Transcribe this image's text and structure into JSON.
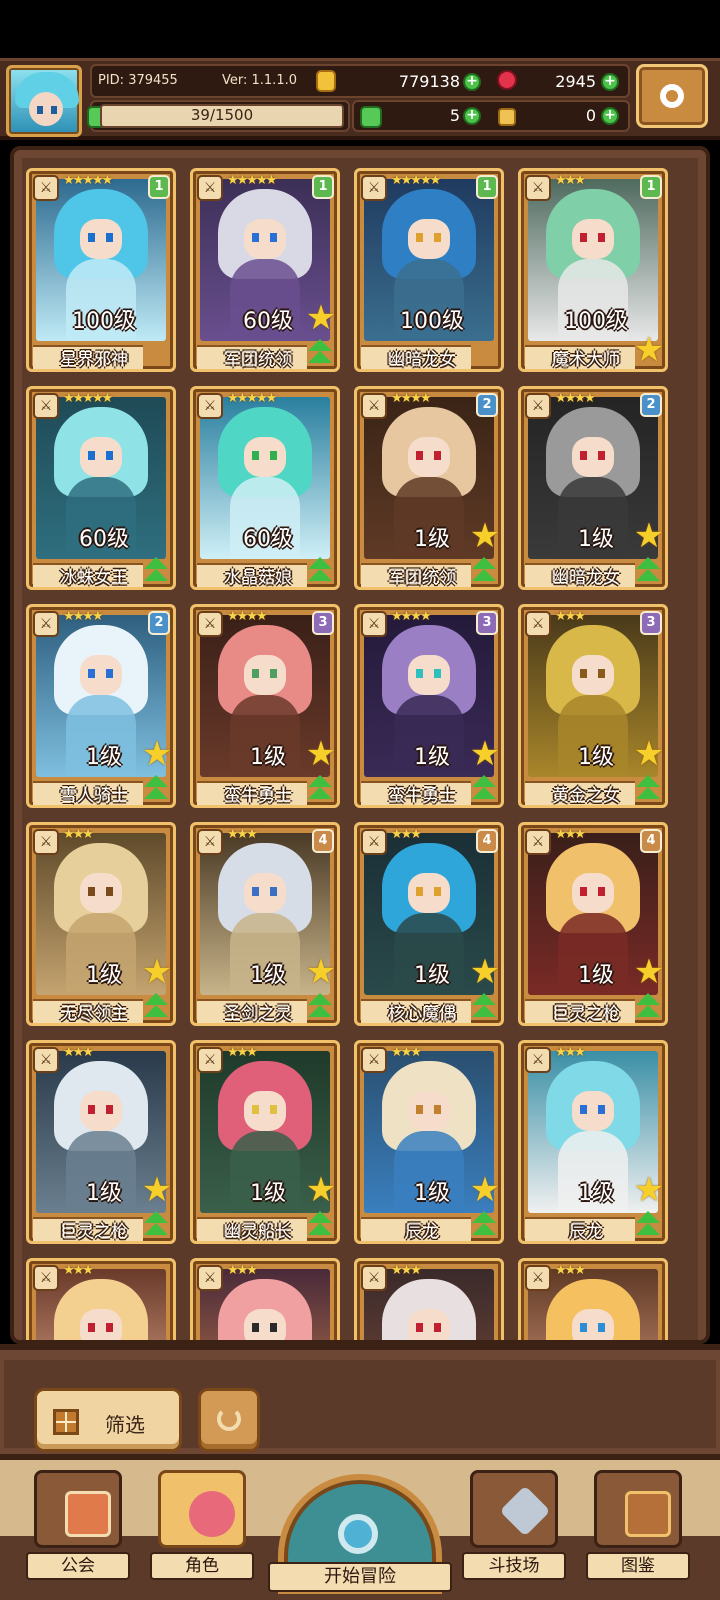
{
  "header": {
    "pid": "PID: 379455",
    "version": "Ver: 1.1.1.0",
    "gold": "779138",
    "gems": "2945",
    "exp": "39/1500",
    "clover_count": "5",
    "bone_count": "0"
  },
  "characters": [
    {
      "level": "100级",
      "name": "星界邪神",
      "stars": "★★★★★",
      "rank": "1",
      "star_badge": false,
      "up": false,
      "hair": "#4fc6e8",
      "body": "#bfeaf6",
      "bg": "#2d6a8f",
      "eye": "#1a6fd0"
    },
    {
      "level": "60级",
      "name": "军团统领",
      "stars": "★★★★★",
      "rank": "1",
      "star_badge": true,
      "up": true,
      "hair": "#d9d9e6",
      "body": "#6a4f8f",
      "bg": "#3b2f56",
      "eye": "#2a6fd6"
    },
    {
      "level": "100级",
      "name": "幽暗龙女",
      "stars": "★★★★★",
      "rank": "1",
      "star_badge": false,
      "up": false,
      "hair": "#2f7fc4",
      "body": "#3b6f8f",
      "bg": "#1f3a5f",
      "eye": "#e0a030"
    },
    {
      "level": "100级",
      "name": "魔术大师",
      "stars": "★★★",
      "rank": "1",
      "star_badge": true,
      "up": false,
      "hair": "#7fcfa8",
      "body": "#e8e8e8",
      "bg": "#4f6a5f",
      "eye": "#c02030"
    },
    {
      "level": "60级",
      "name": "冰蛛女王",
      "stars": "★★★★★",
      "rank": "",
      "star_badge": false,
      "up": true,
      "hair": "#8fe3e6",
      "body": "#2f6f7f",
      "bg": "#1f4a56",
      "eye": "#1a6fd0"
    },
    {
      "level": "60级",
      "name": "水晶菇娘",
      "stars": "★★★★★",
      "rank": "",
      "star_badge": false,
      "up": true,
      "hair": "#4fd6c4",
      "body": "#cfeff6",
      "bg": "#2a7f9f",
      "eye": "#2faf4f"
    },
    {
      "level": "1级",
      "name": "军团统领",
      "stars": "★★★★",
      "rank": "2",
      "star_badge": true,
      "up": true,
      "hair": "#e6c79f",
      "body": "#5f3a26",
      "bg": "#3a2416",
      "eye": "#c02030"
    },
    {
      "level": "1级",
      "name": "幽暗龙女",
      "stars": "★★★★",
      "rank": "2",
      "star_badge": true,
      "up": true,
      "hair": "#9a9a9a",
      "body": "#3a3a3a",
      "bg": "#242424",
      "eye": "#c02030"
    },
    {
      "level": "1级",
      "name": "雪人骑士",
      "stars": "★★★★",
      "rank": "2",
      "star_badge": true,
      "up": true,
      "hair": "#e8f4fa",
      "body": "#7fbfdf",
      "bg": "#2f5f7f",
      "eye": "#2a6fd6"
    },
    {
      "level": "1级",
      "name": "蛮牛勇士",
      "stars": "★★★★",
      "rank": "3",
      "star_badge": true,
      "up": true,
      "hair": "#e88a86",
      "body": "#6a3a2a",
      "bg": "#3a2018",
      "eye": "#4fa060"
    },
    {
      "level": "1级",
      "name": "蛮牛勇士",
      "stars": "★★★★",
      "rank": "3",
      "star_badge": true,
      "up": true,
      "hair": "#9a7fc4",
      "body": "#3a2a56",
      "bg": "#241a3a",
      "eye": "#2fbfbf"
    },
    {
      "level": "1级",
      "name": "黄金之女",
      "stars": "★★★",
      "rank": "3",
      "star_badge": true,
      "up": true,
      "hair": "#d9b84a",
      "body": "#a8862a",
      "bg": "#4a3a1a",
      "eye": "#8a5a1a"
    },
    {
      "level": "1级",
      "name": "无尽领主",
      "stars": "★★★",
      "rank": "",
      "star_badge": true,
      "up": true,
      "hair": "#e6cf9a",
      "body": "#c4a470",
      "bg": "#5f4a2a",
      "eye": "#7a4a1a"
    },
    {
      "level": "1级",
      "name": "圣剑之灵",
      "stars": "★★★",
      "rank": "4",
      "star_badge": true,
      "up": true,
      "hair": "#d6dde6",
      "body": "#c8b48a",
      "bg": "#4a3a26",
      "eye": "#3a6fc4"
    },
    {
      "level": "1级",
      "name": "核心魔偶",
      "stars": "★★★",
      "rank": "4",
      "star_badge": true,
      "up": true,
      "hair": "#2fa6d9",
      "body": "#2a4a4a",
      "bg": "#1a2f36",
      "eye": "#e0a030"
    },
    {
      "level": "1级",
      "name": "巨灵之枪",
      "stars": "★★★",
      "rank": "4",
      "star_badge": true,
      "up": true,
      "hair": "#f0c06a",
      "body": "#7a2a26",
      "bg": "#3a1f1a",
      "eye": "#c02030"
    },
    {
      "level": "1级",
      "name": "巨灵之枪",
      "stars": "★★★",
      "rank": "",
      "star_badge": true,
      "up": true,
      "hair": "#dfe8ef",
      "body": "#6a7f8f",
      "bg": "#2a3a4a",
      "eye": "#c02030"
    },
    {
      "level": "1级",
      "name": "幽灵船长",
      "stars": "★★★",
      "rank": "",
      "star_badge": true,
      "up": true,
      "hair": "#e0607a",
      "body": "#3a5f4a",
      "bg": "#1f3a2a",
      "eye": "#e0c040"
    },
    {
      "level": "1级",
      "name": "辰龙",
      "stars": "★★★",
      "rank": "",
      "star_badge": true,
      "up": true,
      "hair": "#efe2c4",
      "body": "#3a7fbf",
      "bg": "#2a4f6f",
      "eye": "#c08030"
    },
    {
      "level": "1级",
      "name": "辰龙",
      "stars": "★★★",
      "rank": "",
      "star_badge": true,
      "up": true,
      "hair": "#7fd9e6",
      "body": "#f0f0f0",
      "bg": "#3a8fa6",
      "eye": "#2a6fd6"
    },
    {
      "level": "",
      "name": "",
      "stars": "★★★",
      "rank": "",
      "star_badge": false,
      "up": false,
      "hair": "#f4d090",
      "body": "#e8b090",
      "bg": "#6a3a2a",
      "eye": "#c02030"
    },
    {
      "level": "",
      "name": "",
      "stars": "★★★",
      "rank": "",
      "star_badge": false,
      "up": false,
      "hair": "#f0a0a0",
      "body": "#c07a4a",
      "bg": "#4a2a3a",
      "eye": "#2a2a2a"
    },
    {
      "level": "",
      "name": "",
      "stars": "★★★",
      "rank": "",
      "star_badge": false,
      "up": false,
      "hair": "#e8e0e0",
      "body": "#7a4a3a",
      "bg": "#3a2a2a",
      "eye": "#c02030"
    },
    {
      "level": "",
      "name": "",
      "stars": "★★★",
      "rank": "",
      "star_badge": false,
      "up": false,
      "hair": "#f4c060",
      "body": "#e0a080",
      "bg": "#5f3a26",
      "eye": "#2a8fd6"
    }
  ],
  "bottom": {
    "filter_label": "筛选"
  },
  "nav": {
    "guild": "公会",
    "character": "角色",
    "adventure": "开始冒险",
    "arena": "斗技场",
    "codex": "图鉴"
  }
}
